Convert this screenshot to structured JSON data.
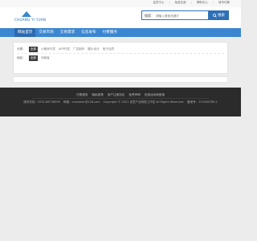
{
  "topbar": {
    "links": [
      "会员中心",
      "免费注册",
      "帮助中心",
      "城市切换"
    ]
  },
  "logo": {
    "text": "CHUANG YI YUAN"
  },
  "search": {
    "label": "搜索：",
    "placeholder": "请输入搜索关键字",
    "button": "搜索"
  },
  "nav": {
    "items": [
      "网站首页",
      "交易市场",
      "交易需求",
      "信息发布",
      "付费服务"
    ],
    "active_index": 0
  },
  "filters": {
    "category": {
      "label": "分类：",
      "selected": "全部",
      "options": [
        "小程序开发",
        "APP开发",
        "广告制作",
        "图片设计",
        "电子合同"
      ]
    },
    "region": {
      "label": "地区：",
      "selected": "全部",
      "options": [
        "河南省"
      ]
    }
  },
  "footer": {
    "links": [
      "付费服务",
      "隐私政策",
      "用户注册协议",
      "免责声明",
      "优惠活动和促销"
    ],
    "info": [
      "服务热线：0532-88738999",
      "邮箱：customer@126.com",
      "Copyright © 2021 创意产业网络工作室 All Rights Reserved.",
      "备案号：123456789-2"
    ]
  },
  "colors": {
    "nav_bg": "#3a86d1",
    "nav_active": "#2a6ab0",
    "search_button": "#2e6fb8",
    "footer_bg": "#2b2b2b"
  }
}
